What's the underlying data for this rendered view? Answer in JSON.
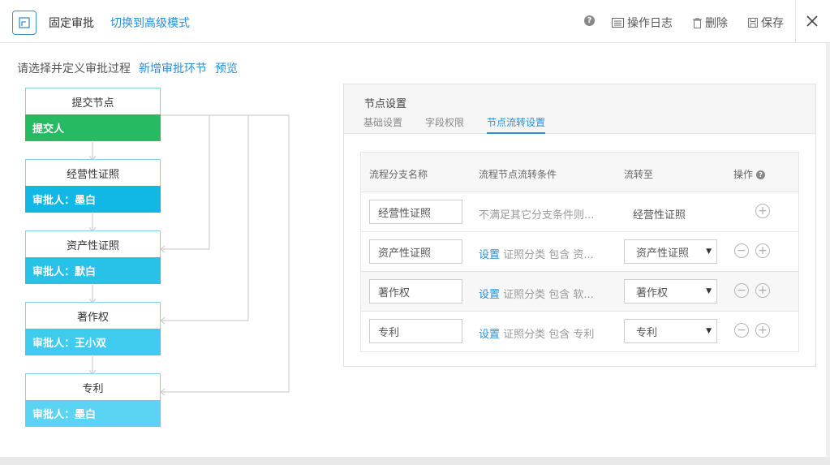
{
  "header": {
    "title": "固定审批",
    "switch_label": "切换到高级模式",
    "help_glyph": "?",
    "actions": {
      "log": "操作日志",
      "delete": "删除",
      "save": "保存"
    }
  },
  "toolbar": {
    "prompt": "请选择并定义审批过程",
    "add_node": "新增审批环节",
    "preview": "预览"
  },
  "flow": {
    "nodes": [
      {
        "title": "提交节点",
        "person": "提交人",
        "color": "#26bb63"
      },
      {
        "title": "经营性证照",
        "person": "审批人：墨白",
        "color": "#11b8e6"
      },
      {
        "title": "资产性证照",
        "person": "审批人：默白",
        "color": "#28c1e8"
      },
      {
        "title": "著作权",
        "person": "审批人：王小双",
        "color": "#3ecbee"
      },
      {
        "title": "专利",
        "person": "审批人：墨白",
        "color": "#5bd3f2"
      }
    ]
  },
  "panel": {
    "title": "节点设置",
    "tabs": [
      "基础设置",
      "字段权限",
      "节点流转设置"
    ],
    "active_tab": "节点流转设置",
    "table": {
      "headers": {
        "name": "流程分支名称",
        "cond": "流程节点流转条件",
        "to": "流转至",
        "op": "操作"
      },
      "help_glyph": "?",
      "rows": [
        {
          "name": "经营性证照",
          "set": "",
          "cond": "不满足其它分支条件则...",
          "to": "经营性证照"
        },
        {
          "name": "资产性证照",
          "set": "设置",
          "cond": "证照分类 包含 资...",
          "to": "资产性证照"
        },
        {
          "name": "著作权",
          "set": "设置",
          "cond": "证照分类 包含 软...",
          "to": "著作权"
        },
        {
          "name": "专利",
          "set": "设置",
          "cond": "证照分类 包含 专利",
          "to": "专利"
        }
      ]
    }
  },
  "colors": {
    "accent": "#2a8fd7",
    "node_border": "#7fd8c8"
  }
}
